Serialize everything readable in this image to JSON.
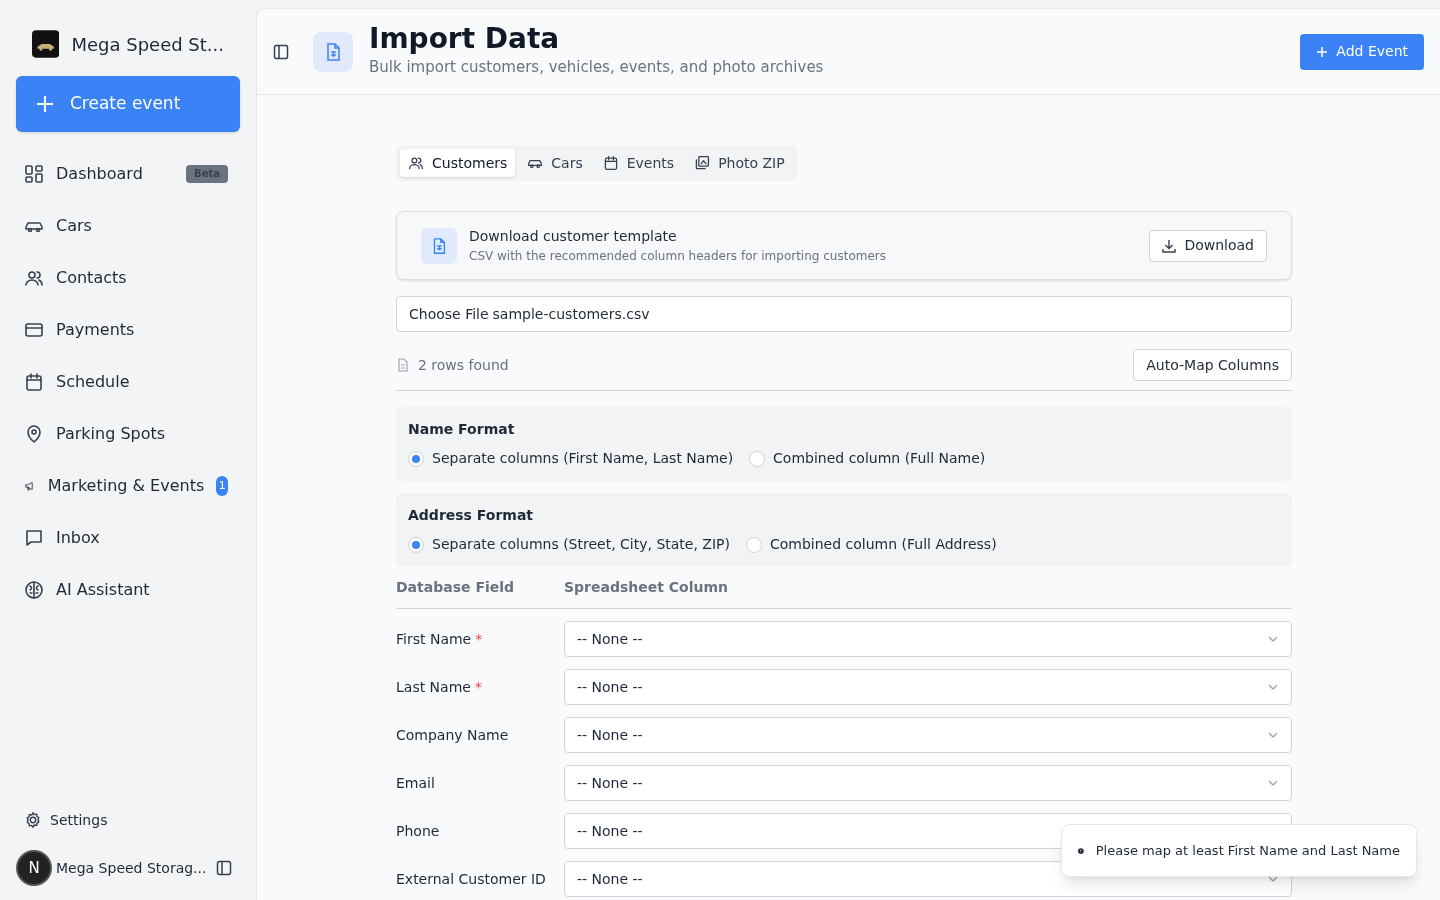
{
  "sidebar": {
    "brand": "Mega Speed St...",
    "create_button": "Create event",
    "items": [
      {
        "label": "Dashboard",
        "badge": "Beta",
        "selected": false
      },
      {
        "label": "Cars",
        "selected": false
      },
      {
        "label": "Contacts",
        "selected": false
      },
      {
        "label": "Payments",
        "selected": false
      },
      {
        "label": "Schedule",
        "selected": false
      },
      {
        "label": "Parking Spots",
        "selected": false
      },
      {
        "label": "Marketing & Events",
        "count": "1",
        "selected": false
      },
      {
        "label": "Inbox",
        "selected": false
      },
      {
        "label": "AI Assistant",
        "selected": false
      }
    ],
    "settings": "Settings",
    "user": {
      "initial": "N",
      "name": "Mega Speed Storag..."
    }
  },
  "header": {
    "title": "Import Data",
    "subtitle": "Bulk import customers, vehicles, events, and photo archives",
    "add_button": "Add Event"
  },
  "tabs": [
    {
      "label": "Customers",
      "selected": true
    },
    {
      "label": "Cars",
      "selected": false
    },
    {
      "label": "Events",
      "selected": false
    },
    {
      "label": "Photo ZIP",
      "selected": false
    }
  ],
  "template": {
    "title": "Download customer template",
    "description": "CSV with the recommended column headers for importing customers",
    "button": "Download"
  },
  "file_input": {
    "button": "Choose File",
    "filename": "sample-customers.csv"
  },
  "rows_found": "2 rows found",
  "auto_map_button": "Auto-Map Columns",
  "formats": [
    {
      "title": "Name Format",
      "options": [
        {
          "label": "Separate columns (First Name, Last Name)",
          "selected": true
        },
        {
          "label": "Combined column (Full Name)",
          "selected": false
        }
      ]
    },
    {
      "title": "Address Format",
      "options": [
        {
          "label": "Separate columns (Street, City, State, ZIP)",
          "selected": true
        },
        {
          "label": "Combined column (Full Address)",
          "selected": false
        }
      ]
    }
  ],
  "mapping": {
    "columns": [
      "Database Field",
      "Spreadsheet Column"
    ],
    "rows": [
      {
        "field": "First Name",
        "marker": "*",
        "value": "-- None --"
      },
      {
        "field": "Last Name",
        "marker": "*",
        "value": "-- None --"
      },
      {
        "field": "Company Name",
        "value": "-- None --"
      },
      {
        "field": "Email",
        "value": "-- None --"
      },
      {
        "field": "Phone",
        "value": "-- None --"
      },
      {
        "field": "External Customer ID",
        "value": "-- None --"
      }
    ]
  },
  "toast": {
    "message": "Please map at least First Name and Last Name"
  }
}
